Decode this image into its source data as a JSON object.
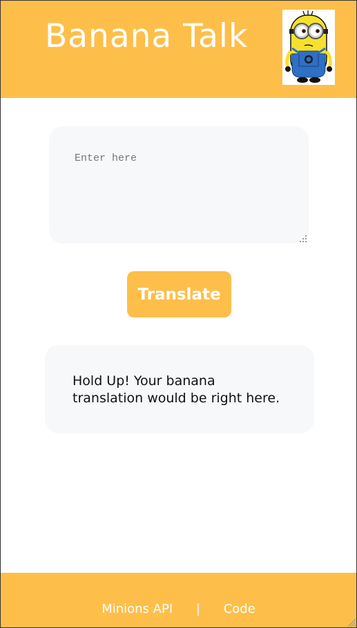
{
  "header": {
    "title": "Banana Talk",
    "mascot_icon": "minion-mascot-icon"
  },
  "input": {
    "placeholder": "Enter here",
    "value": ""
  },
  "translate_button": {
    "label": "Translate"
  },
  "output": {
    "text": "Hold Up! Your banana translation would be right here."
  },
  "footer": {
    "link_api": "Minions API",
    "separator": "|",
    "link_code": "Code"
  },
  "colors": {
    "accent": "#fdbf4a",
    "panel_bg": "#f7f8fa",
    "text": "#111111"
  }
}
